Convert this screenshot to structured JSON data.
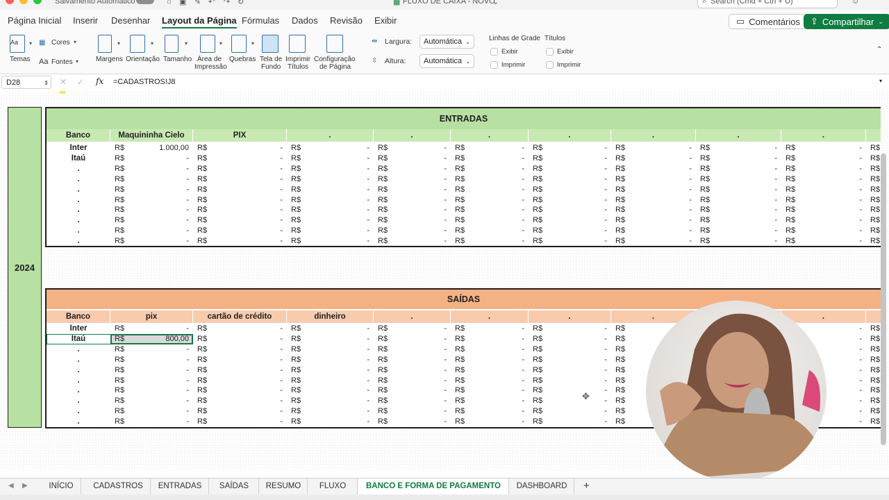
{
  "window": {
    "autosave_label": "Salvamento Automático",
    "doc_title": "FLUXO DE CAIXA - NOVO",
    "search_placeholder": "Search (Cmd + Ctrl + U)"
  },
  "ribbon_tabs": [
    "Página Inicial",
    "Inserir",
    "Desenhar",
    "Layout da Página",
    "Fórmulas",
    "Dados",
    "Revisão",
    "Exibir"
  ],
  "active_ribbon_tab": "Layout da Página",
  "top_buttons": {
    "comments": "Comentários",
    "share": "Compartilhar"
  },
  "ribbon": {
    "temas": "Temas",
    "cores": "Cores",
    "fontes": "Fontes",
    "margens": "Margens",
    "orientacao": "Orientação",
    "tamanho": "Tamanho",
    "area_l1": "Área de",
    "area_l2": "Impressão",
    "quebras": "Quebras",
    "tela_l1": "Tela de",
    "tela_l2": "Fundo",
    "imprimir_l1": "Imprimir",
    "imprimir_l2": "Títulos",
    "config_l1": "Configuração",
    "config_l2": "de Página",
    "largura_label": "Largura:",
    "largura_value": "Automática",
    "altura_label": "Altura:",
    "altura_value": "Automática",
    "linhas_grade": "Linhas de Grade",
    "titulos": "Títulos",
    "exibir": "Exibir",
    "imprimir": "Imprimir"
  },
  "formula_bar": {
    "cell_ref": "D28",
    "fx": "fx",
    "formula": "=CADASTROS!J8"
  },
  "year_label": "2024",
  "entradas": {
    "title": "ENTRADAS",
    "headers": [
      "Banco",
      "Maquininha Cielo",
      "PIX",
      ".",
      ".",
      ".",
      ".",
      ".",
      ".",
      "."
    ],
    "banks": [
      "Inter",
      "Itaú",
      ".",
      ".",
      ".",
      ".",
      ".",
      ".",
      ".",
      "."
    ],
    "first_values": [
      "1.000,00",
      "-",
      "-",
      "-",
      "-",
      "-",
      "-",
      "-",
      "-",
      "-"
    ]
  },
  "saidas": {
    "title": "SAÍDAS",
    "headers": [
      "Banco",
      "pix",
      "cartão de crédito",
      "dinheiro",
      ".",
      ".",
      ".",
      ".",
      ".",
      "."
    ],
    "banks": [
      "Inter",
      "Itaú",
      ".",
      ".",
      ".",
      ".",
      ".",
      ".",
      ".",
      "."
    ],
    "first_values": [
      "-",
      "800,00",
      "-",
      "-",
      "-",
      "-",
      "-",
      "-",
      "-",
      "-"
    ]
  },
  "currency": "R$",
  "dash": "-",
  "sheet_tabs": [
    "INÍCIO",
    "CADASTROS",
    "ENTRADAS",
    "SAÍDAS",
    "RESUMO",
    "FLUXO",
    "BANCO E FORMA DE PAGAMENTO",
    "DASHBOARD"
  ],
  "active_sheet": "BANCO E FORMA DE PAGAMENTO",
  "add_sheet": "+",
  "colors": {
    "excel_green": "#107c41",
    "entradas_header": "#b7e0a3",
    "entradas_sub": "#c9e9b3",
    "saidas_header": "#f4b183",
    "saidas_sub": "#f8cbad",
    "year_col": "#b7e0a3"
  }
}
